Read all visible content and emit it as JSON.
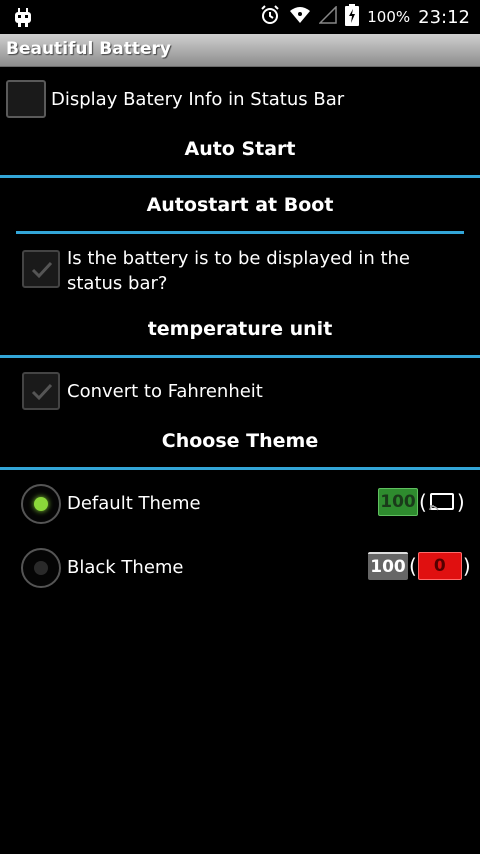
{
  "status_bar": {
    "battery_percent": "100%",
    "time": "23:12"
  },
  "title_bar": {
    "title": "Beautiful Battery"
  },
  "settings": {
    "display_info_label": "Display Batery Info in Status Bar",
    "display_info_checked": false,
    "section_auto_start": "Auto Start",
    "section_autostart_boot": "Autostart at Boot",
    "boot_label": "Is the battery is to be displayed in the status bar?",
    "boot_checked": true,
    "section_temperature": "temperature unit",
    "fahrenheit_label": "Convert to Fahrenheit",
    "fahrenheit_checked": true,
    "section_theme": "Choose Theme",
    "themes": [
      {
        "label": "Default Theme",
        "selected": true,
        "preview_value": "100",
        "preview_color": "#2e8b2e"
      },
      {
        "label": "Black Theme",
        "selected": false,
        "preview_value": "100",
        "preview_badge": "0",
        "preview_color": "#e01010"
      }
    ]
  },
  "colors": {
    "accent_divider": "#33a6d8",
    "radio_selected": "#8bd83a"
  }
}
